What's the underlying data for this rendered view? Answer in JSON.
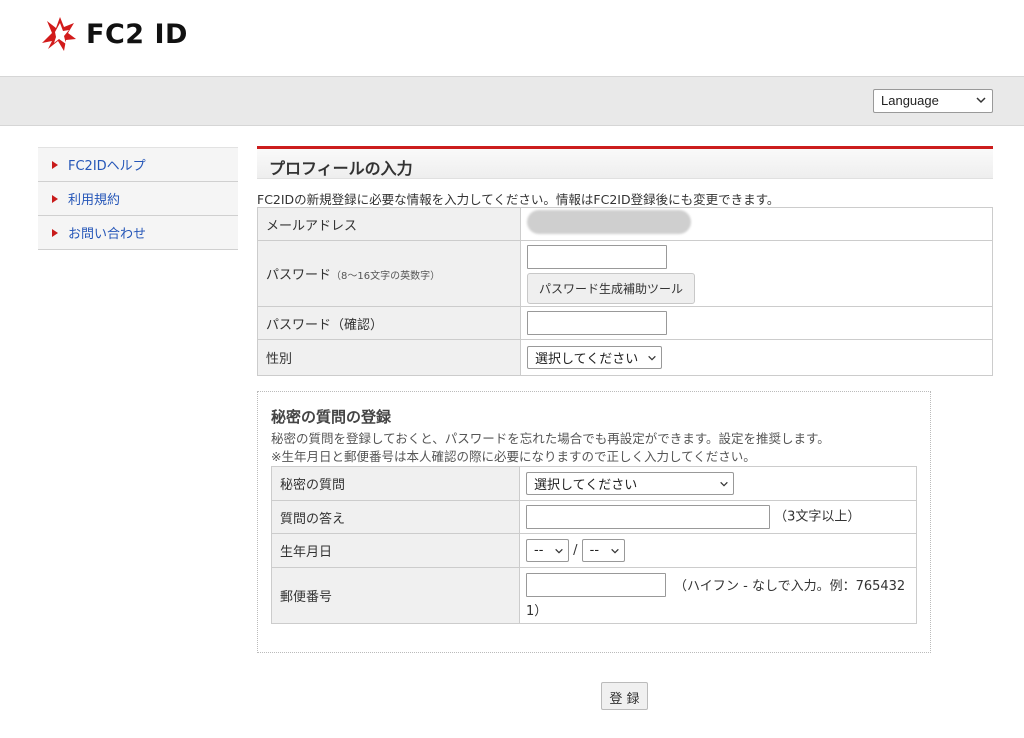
{
  "header": {
    "logo_text": "FC2 ID"
  },
  "language": {
    "label": "Language"
  },
  "sidebar": {
    "items": [
      {
        "label": "FC2IDヘルプ"
      },
      {
        "label": "利用規約"
      },
      {
        "label": "お問い合わせ"
      }
    ]
  },
  "profile": {
    "title": "プロフィールの入力",
    "intro": "FC2IDの新規登録に必要な情報を入力してください。情報はFC2ID登録後にも変更できます。",
    "email_label": "メールアドレス",
    "password_label": "パスワード",
    "password_note": "（8～16文字の英数字）",
    "password_tool_button": "パスワード生成補助ツール",
    "password_confirm_label": "パスワード（確認）",
    "gender_label": "性別",
    "gender_select": "選択してください"
  },
  "secret": {
    "title": "秘密の質問の登録",
    "desc1": "秘密の質問を登録しておくと、パスワードを忘れた場合でも再設定ができます。設定を推奨します。",
    "desc2": "※生年月日と郵便番号は本人確認の際に必要になりますので正しく入力してください。",
    "question_label": "秘密の質問",
    "question_select": "選択してください",
    "answer_label": "質問の答え",
    "answer_note": "（3文字以上）",
    "birthday_label": "生年月日",
    "birthday_month": "--",
    "birthday_sep": "/",
    "birthday_day": "--",
    "zip_label": "郵便番号",
    "zip_note_line1": "（ハイフン - なしで入力。例：765432",
    "zip_note_line2": "1）"
  },
  "submit_label": "登 録",
  "colors": {
    "accent": "#cc1d1d",
    "link": "#2556b8"
  }
}
